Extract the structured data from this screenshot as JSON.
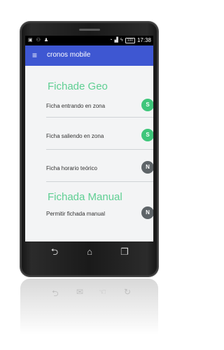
{
  "status_bar": {
    "time": "17:38",
    "battery": "100"
  },
  "app_bar": {
    "menu_icon": "hamburger-icon",
    "title": "cronos mobile",
    "color": "#3e57d2"
  },
  "sections": [
    {
      "title": "Fichade Geo",
      "items": [
        {
          "label": "Ficha entrando en zona",
          "badge": "S",
          "state": "on"
        },
        {
          "label": "Ficha saliendo en zona",
          "badge": "S",
          "state": "on"
        },
        {
          "label": "Ficha horario teórico",
          "badge": "N",
          "state": "off"
        }
      ]
    },
    {
      "title": "Fichada Manual",
      "items": [
        {
          "label": "Permitir fichada manual",
          "badge": "N",
          "state": "off"
        }
      ]
    }
  ],
  "colors": {
    "accent_green": "#5fcf93",
    "badge_on": "#3fc67b",
    "badge_off": "#5e6468"
  },
  "nav_bar": {
    "back_icon": "back-icon",
    "home_icon": "home-icon",
    "recents_icon": "recents-icon"
  }
}
